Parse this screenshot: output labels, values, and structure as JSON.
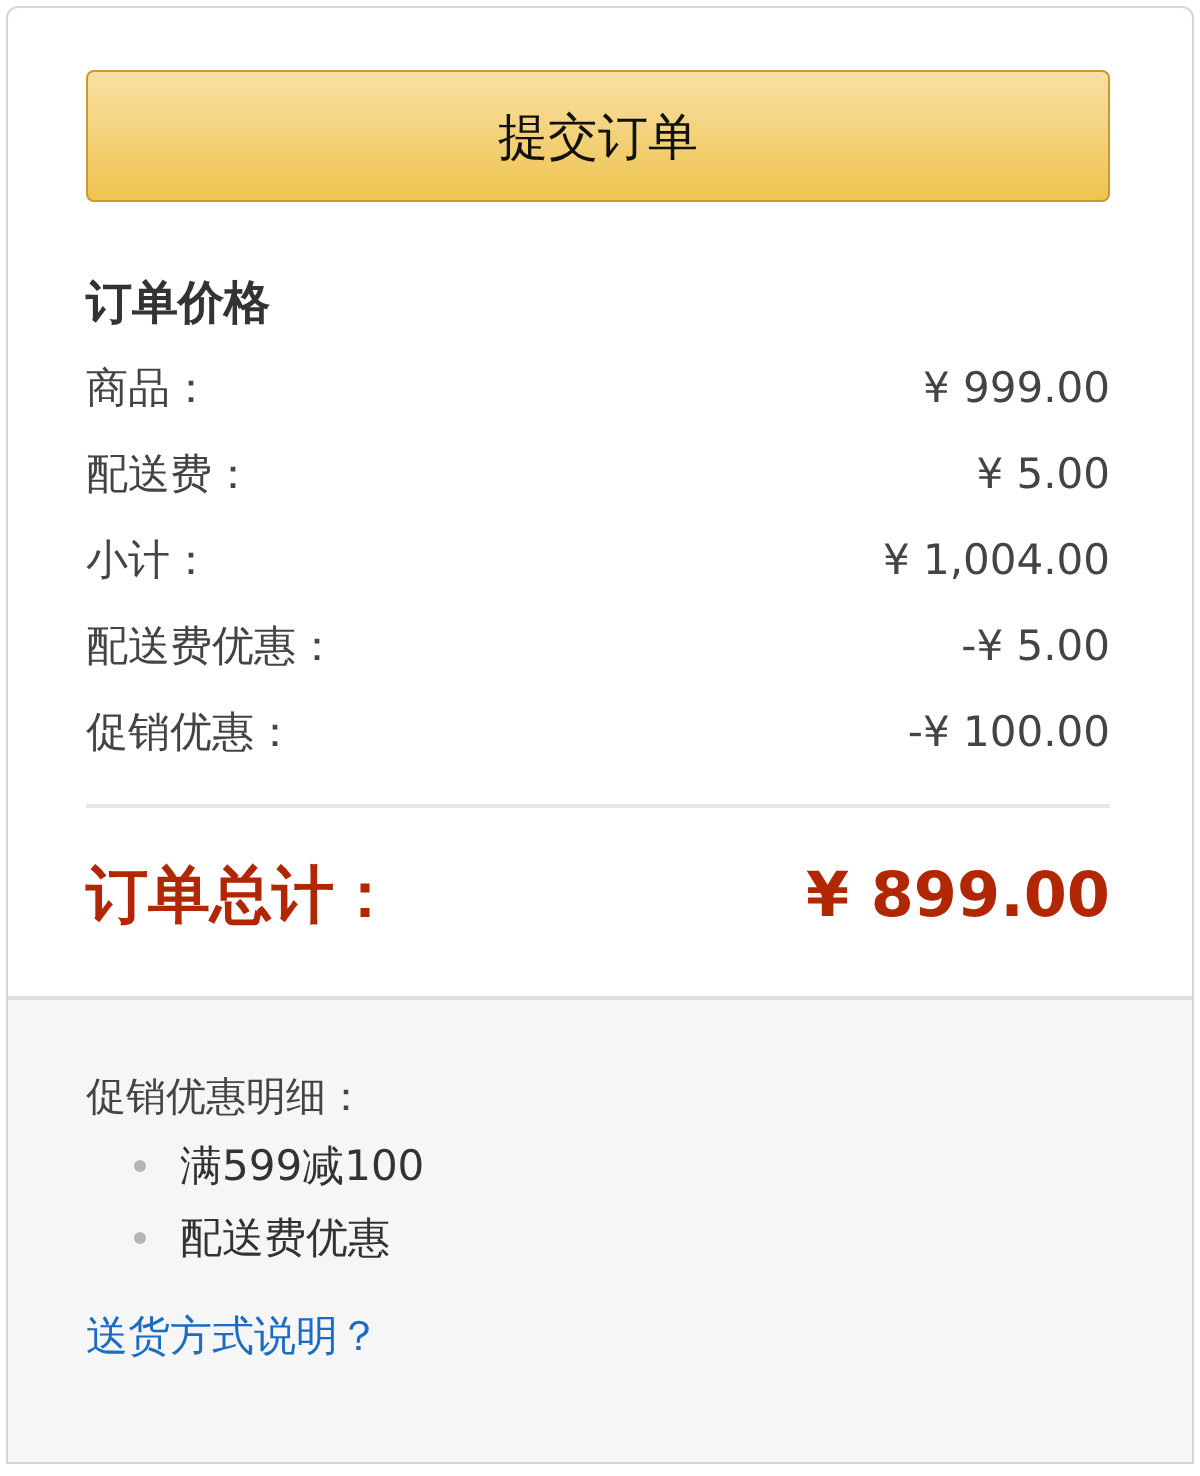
{
  "submit_button": {
    "label": "提交订单"
  },
  "price_summary": {
    "title": "订单价格",
    "rows": [
      {
        "label": "商品：",
        "amount": "¥ 999.00"
      },
      {
        "label": "配送费：",
        "amount": "¥ 5.00"
      },
      {
        "label": "小计：",
        "amount": "¥ 1,004.00"
      },
      {
        "label": "配送费优惠：",
        "amount": "-¥ 5.00"
      },
      {
        "label": "促销优惠：",
        "amount": "-¥ 100.00"
      }
    ],
    "total": {
      "label": "订单总计：",
      "amount": "¥ 899.00"
    }
  },
  "promotion_details": {
    "title": "促销优惠明细：",
    "items": [
      "满599减100",
      "配送费优惠"
    ]
  },
  "shipping_link": "送货方式说明？"
}
